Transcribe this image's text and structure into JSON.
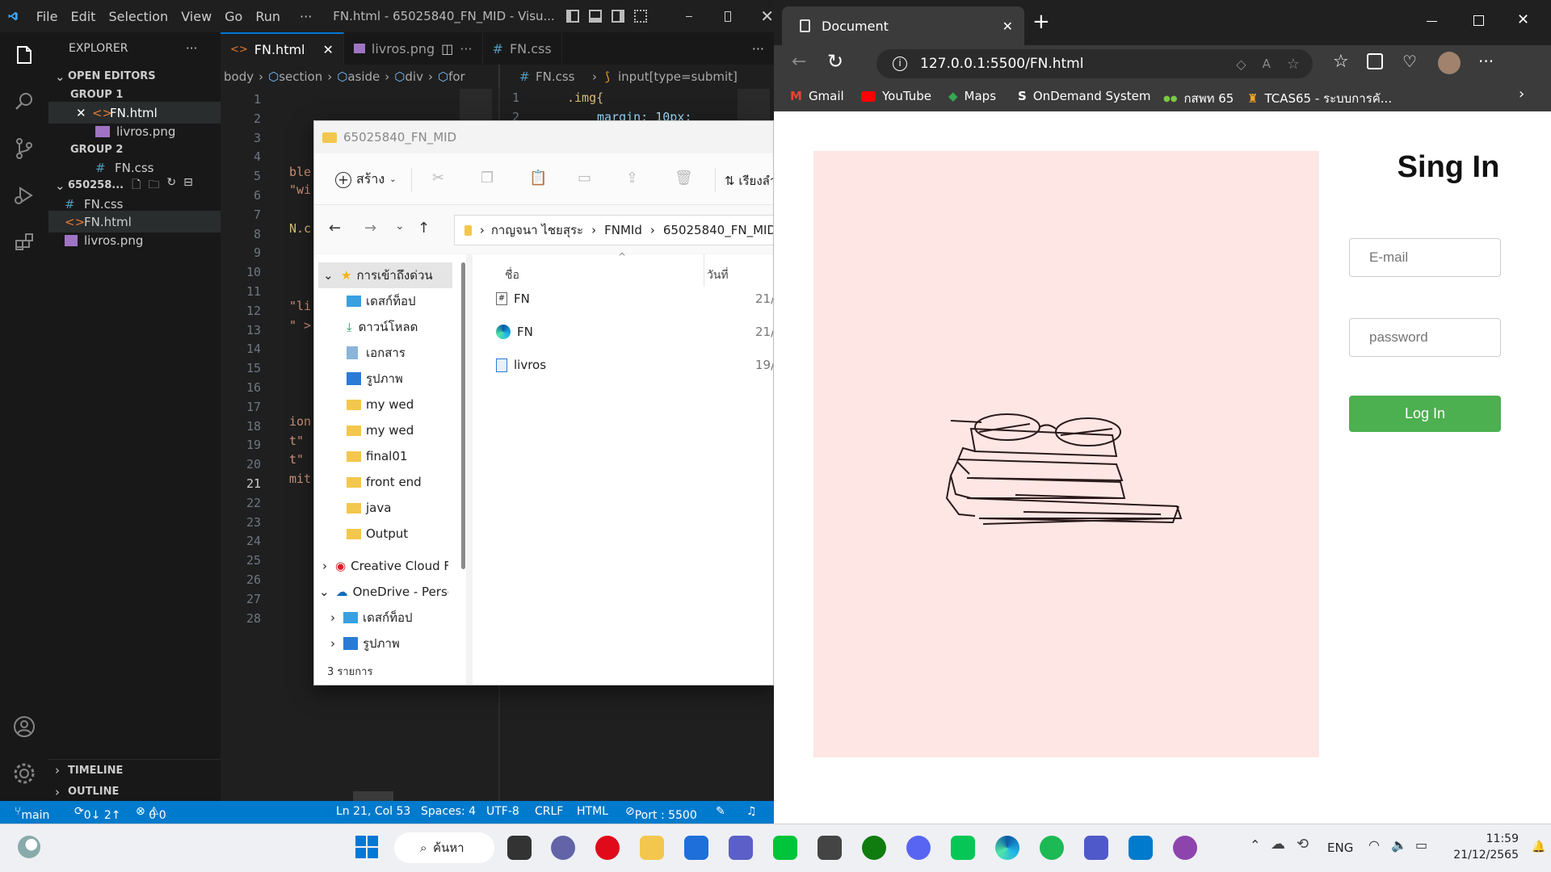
{
  "vscode": {
    "menu": [
      "File",
      "Edit",
      "Selection",
      "View",
      "Go",
      "Run",
      "···"
    ],
    "window_title": "FN.html - 65025840_FN_MID - Visu...",
    "explorer": {
      "header": "EXPLORER",
      "open_editors": "OPEN EDITORS",
      "group1": "GROUP 1",
      "group2": "GROUP 2",
      "open_files": [
        "FN.html",
        "livros.png",
        "FN.css"
      ],
      "folder": "650258...",
      "files": [
        "FN.css",
        "FN.html",
        "livros.png"
      ],
      "timeline": "TIMELINE",
      "outline": "OUTLINE"
    },
    "tabs": [
      "FN.html",
      "livros.png",
      "FN.css"
    ],
    "breadcrumb_left": [
      "body",
      "section",
      "aside",
      "div",
      "for"
    ],
    "breadcrumb_right": [
      "FN.css",
      "input[type=submit]"
    ],
    "line_numbers": [
      "1",
      "2",
      "3",
      "4",
      "5",
      "6",
      "7",
      "8",
      "9",
      "10",
      "11",
      "12",
      "13",
      "14",
      "15",
      "16",
      "17",
      "18",
      "19",
      "20",
      "21",
      "22",
      "23",
      "24",
      "25",
      "26",
      "27",
      "28"
    ],
    "code_fragments": [
      "ble",
      "\"wi",
      "N.c",
      "\"li",
      "\" >",
      "ion",
      "t\"",
      "t\"",
      "mit"
    ],
    "css_lines": [
      ".img{",
      "margin: 10px;"
    ],
    "css_line_numbers": [
      "1",
      "2"
    ],
    "status": {
      "branch": "main",
      "sync": "0↓ 2↑",
      "problems": "0",
      "warnings": "0",
      "position": "Ln 21, Col 53",
      "spaces": "Spaces: 4",
      "encoding": "UTF-8",
      "eol": "CRLF",
      "language": "HTML",
      "port": "Port : 5500"
    }
  },
  "file_explorer": {
    "title": "65025840_FN_MID",
    "new_label": "สร้าง",
    "sort_label": "เรียงลำ",
    "breadcrumb": [
      "กาญจนา ไชยสุระ",
      "FNMId",
      "65025840_FN_MID"
    ],
    "nav": [
      "การเข้าถึงด่วน",
      "เดสก์ท็อป",
      "ดาวน์โหลด",
      "เอกสาร",
      "รูปภาพ",
      "my wed",
      "my wed",
      "final01",
      "front end",
      "java",
      "Output",
      "Creative Cloud Files",
      "OneDrive - Personal",
      "เดสก์ท็อป",
      "รูปภาพ"
    ],
    "col_name": "ชื่อ",
    "col_date": "วันที่",
    "files": [
      {
        "name": "FN",
        "date": "21/"
      },
      {
        "name": "FN",
        "date": "21/"
      },
      {
        "name": "livros",
        "date": "19/"
      }
    ],
    "count": "3 รายการ"
  },
  "browser": {
    "tab_title": "Document",
    "url": "127.0.0.1:5500/FN.html",
    "bookmarks": [
      "Gmail",
      "YouTube",
      "Maps",
      "OnDemand System",
      "กสพท 65",
      "TCAS65 - ระบบการคั..."
    ],
    "page": {
      "title": "Sing In",
      "email_placeholder": "E-mail",
      "password_placeholder": "password",
      "login": "Log In",
      "pink": "#fde6e3",
      "button_color": "#4caf50"
    }
  },
  "taskbar": {
    "search": "ค้นหา",
    "lang": "ENG",
    "time": "11:59",
    "date": "21/12/2565"
  }
}
